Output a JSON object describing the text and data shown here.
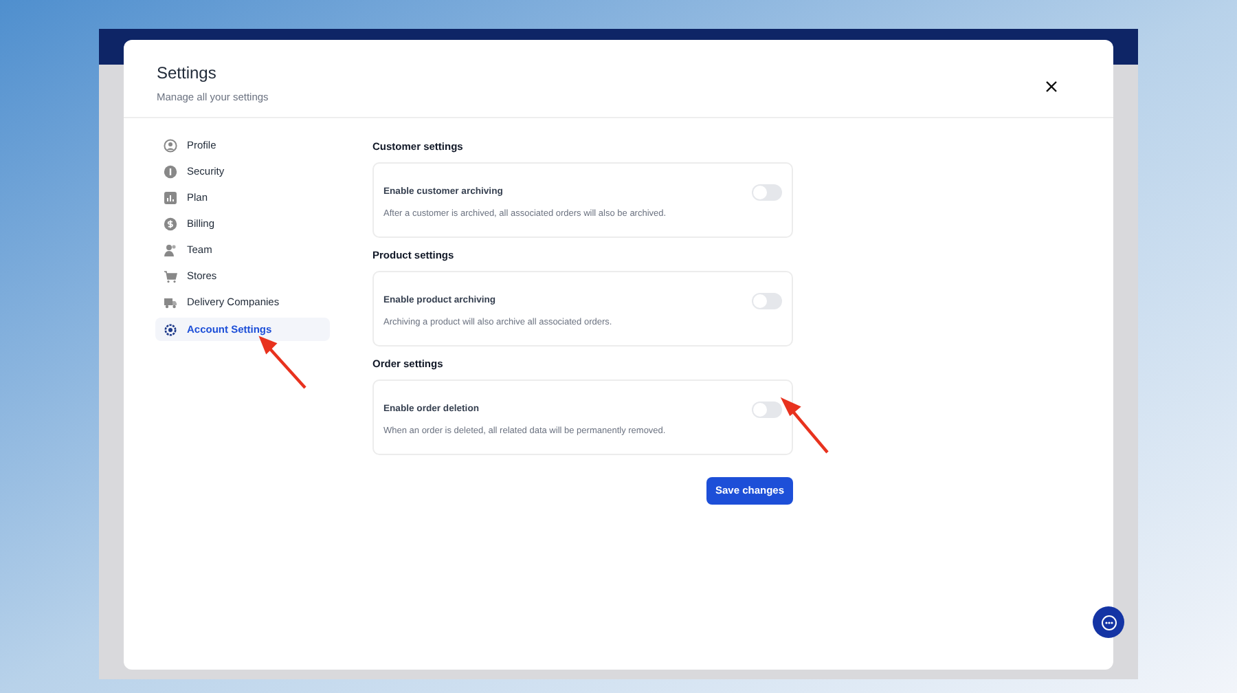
{
  "modal": {
    "title": "Settings",
    "subtitle": "Manage all your settings"
  },
  "nav": [
    {
      "label": "Profile",
      "selected": false
    },
    {
      "label": "Security",
      "selected": false
    },
    {
      "label": "Plan",
      "selected": false
    },
    {
      "label": "Billing",
      "selected": false
    },
    {
      "label": "Team",
      "selected": false
    },
    {
      "label": "Stores",
      "selected": false
    },
    {
      "label": "Delivery Companies",
      "selected": false
    },
    {
      "label": "Account Settings",
      "selected": true
    }
  ],
  "sections": [
    {
      "title": "Customer settings",
      "setting": {
        "label": "Enable customer archiving",
        "description": "After a customer is archived, all associated orders will also be archived.",
        "on": false
      }
    },
    {
      "title": "Product settings",
      "setting": {
        "label": "Enable product archiving",
        "description": "Archiving a product will also archive all associated orders.",
        "on": false
      }
    },
    {
      "title": "Order settings",
      "setting": {
        "label": "Enable order deletion",
        "description": "When an order is deleted, all related data will be permanently removed.",
        "on": false
      }
    }
  ],
  "save_button": "Save changes"
}
